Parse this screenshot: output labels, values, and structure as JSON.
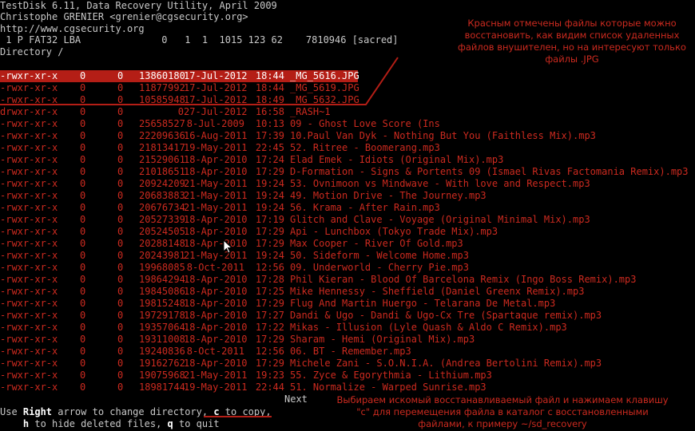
{
  "header": {
    "line1": "TestDisk 6.11, Data Recovery Utility, April 2009",
    "line2": "Christophe GRENIER <grenier@cgsecurity.org>",
    "line3": "http://www.cgsecurity.org",
    "partition": " 1 P FAT32 LBA              0   1  1  1015 123 62    7810946 [sacred]",
    "directory": "Directory /"
  },
  "files": [
    {
      "perm": "-rwxr-xr-x",
      "uid": "0",
      "gid": "0",
      "size": "13860180",
      "date": "17-Jul-2012",
      "time": "18:44",
      "name": "_MG_5616.JPG",
      "selected": true
    },
    {
      "perm": "-rwxr-xr-x",
      "uid": "0",
      "gid": "0",
      "size": "11877992",
      "date": "17-Jul-2012",
      "time": "18:44",
      "name": "_MG_5619.JPG"
    },
    {
      "perm": "-rwxr-xr-x",
      "uid": "0",
      "gid": "0",
      "size": "10585948",
      "date": "17-Jul-2012",
      "time": "18:49",
      "name": "_MG_5632.JPG"
    },
    {
      "perm": "drwxr-xr-x",
      "uid": "0",
      "gid": "0",
      "size": "0",
      "date": "27-Jul-2012",
      "time": "16:58",
      "name": "_RASH~1",
      "dir": true
    },
    {
      "perm": "-rwxr-xr-x",
      "uid": "0",
      "gid": "0",
      "size": "25658527",
      "date": "8-Jul-2009",
      "time": "10:13",
      "name": "09 - Ghost Love Score (Ins"
    },
    {
      "perm": "-rwxr-xr-x",
      "uid": "0",
      "gid": "0",
      "size": "22209636",
      "date": "16-Aug-2011",
      "time": "17:39",
      "name": "10.Paul Van Dyk - Nothing But You (Faithless Mix).mp3"
    },
    {
      "perm": "-rwxr-xr-x",
      "uid": "0",
      "gid": "0",
      "size": "21813417",
      "date": "19-May-2011",
      "time": "22:45",
      "name": "52. Ritree - Boomerang.mp3"
    },
    {
      "perm": "-rwxr-xr-x",
      "uid": "0",
      "gid": "0",
      "size": "21529061",
      "date": "18-Apr-2010",
      "time": "17:24",
      "name": "Elad Emek - Idiots (Original Mix).mp3"
    },
    {
      "perm": "-rwxr-xr-x",
      "uid": "0",
      "gid": "0",
      "size": "21018651",
      "date": "18-Apr-2010",
      "time": "17:29",
      "name": "D-Formation - Signs & Portents 09 (Ismael Rivas Factomania Remix).mp3"
    },
    {
      "perm": "-rwxr-xr-x",
      "uid": "0",
      "gid": "0",
      "size": "20924209",
      "date": "21-May-2011",
      "time": "19:24",
      "name": "53. Ovnimoon vs Mindwave - With love and Respect.mp3"
    },
    {
      "perm": "-rwxr-xr-x",
      "uid": "0",
      "gid": "0",
      "size": "20683883",
      "date": "21-May-2011",
      "time": "19:24",
      "name": "49. Motion Drive - The Journey.mp3"
    },
    {
      "perm": "-rwxr-xr-x",
      "uid": "0",
      "gid": "0",
      "size": "20676734",
      "date": "21-May-2011",
      "time": "19:24",
      "name": "56. Krama - After Rain.mp3"
    },
    {
      "perm": "-rwxr-xr-x",
      "uid": "0",
      "gid": "0",
      "size": "20527339",
      "date": "18-Apr-2010",
      "time": "17:19",
      "name": "Glitch and Clave - Voyage (Original Minimal Mix).mp3"
    },
    {
      "perm": "-rwxr-xr-x",
      "uid": "0",
      "gid": "0",
      "size": "20524505",
      "date": "18-Apr-2010",
      "time": "17:29",
      "name": "Api - Lunchbox (Tokyo Trade Mix).mp3"
    },
    {
      "perm": "-rwxr-xr-x",
      "uid": "0",
      "gid": "0",
      "size": "20288148",
      "date": "18-Apr-2010",
      "time": "17:29",
      "name": "Max Cooper - River Of Gold.mp3"
    },
    {
      "perm": "-rwxr-xr-x",
      "uid": "0",
      "gid": "0",
      "size": "20243981",
      "date": "21-May-2011",
      "time": "19:24",
      "name": "50. Sideform - Welcome Home.mp3"
    },
    {
      "perm": "-rwxr-xr-x",
      "uid": "0",
      "gid": "0",
      "size": "19968085",
      "date": "8-Oct-2011",
      "time": "12:56",
      "name": "09. Underworld - Cherry Pie.mp3"
    },
    {
      "perm": "-rwxr-xr-x",
      "uid": "0",
      "gid": "0",
      "size": "19864294",
      "date": "18-Apr-2010",
      "time": "17:28",
      "name": "Phil Kieran - Blood Of Barcelona Remix (Ingo Boss Remix).mp3"
    },
    {
      "perm": "-rwxr-xr-x",
      "uid": "0",
      "gid": "0",
      "size": "19845086",
      "date": "18-Apr-2010",
      "time": "17:25",
      "name": "Mike Hennessy - Sheffield (Daniel Greenx Remix).mp3"
    },
    {
      "perm": "-rwxr-xr-x",
      "uid": "0",
      "gid": "0",
      "size": "19815248",
      "date": "18-Apr-2010",
      "time": "17:29",
      "name": "Flug And Martin Huergo - Telarana De Metal.mp3"
    },
    {
      "perm": "-rwxr-xr-x",
      "uid": "0",
      "gid": "0",
      "size": "19729178",
      "date": "18-Apr-2010",
      "time": "17:27",
      "name": "Dandi & Ugo - Dandi & Ugo-Cx Tre (Spartaque remix).mp3"
    },
    {
      "perm": "-rwxr-xr-x",
      "uid": "0",
      "gid": "0",
      "size": "19357064",
      "date": "18-Apr-2010",
      "time": "17:22",
      "name": "Mikas - Illusion (Lyle Quash & Aldo C Remix).mp3"
    },
    {
      "perm": "-rwxr-xr-x",
      "uid": "0",
      "gid": "0",
      "size": "19311008",
      "date": "18-Apr-2010",
      "time": "17:29",
      "name": "Sharam - Hemi (Original Mix).mp3"
    },
    {
      "perm": "-rwxr-xr-x",
      "uid": "0",
      "gid": "0",
      "size": "19240836",
      "date": "8-Oct-2011",
      "time": "12:56",
      "name": "06. BT - Remember.mp3"
    },
    {
      "perm": "-rwxr-xr-x",
      "uid": "0",
      "gid": "0",
      "size": "19162762",
      "date": "18-Apr-2010",
      "time": "17:29",
      "name": "Michele Zani - S.O.N.I.A. (Andrea Bertolini Remix).mp3"
    },
    {
      "perm": "-rwxr-xr-x",
      "uid": "0",
      "gid": "0",
      "size": "19075968",
      "date": "21-May-2011",
      "time": "19:23",
      "name": "55. Zyce & Egorythmia - Lithium.mp3"
    },
    {
      "perm": "-rwxr-xr-x",
      "uid": "0",
      "gid": "0",
      "size": "18981744",
      "date": "19-May-2011",
      "time": "22:44",
      "name": "51. Normalize - Warped Sunrise.mp3"
    }
  ],
  "footer": {
    "next": "Next",
    "help1_prefix": "Use ",
    "help1_key1": "Right",
    "help1_mid": " arrow to change directory, ",
    "help1_key2": "c",
    "help1_suffix": " to copy,",
    "help2_indent": "    ",
    "help2_key1": "h",
    "help2_mid": " to hide deleted files, ",
    "help2_key2": "q",
    "help2_suffix": " to quit"
  },
  "annotations": {
    "top": "Красным отмечены файлы которые можно восстановить, как видим список удаленных файлов внушителен, но на интересуют только файлы .JPG",
    "bottom": "Выбираем искомый восстанавливаемый файл и нажимаем клавишу \"c\" для перемещения файла в каталог с восстановленными файлами, к примеру ~/sd_recovery"
  },
  "colors": {
    "deleted_file": "#cc2a1f",
    "selection_bg": "#b41e16",
    "annotation": "#cc2a1f",
    "terminal_bg": "#000000"
  }
}
